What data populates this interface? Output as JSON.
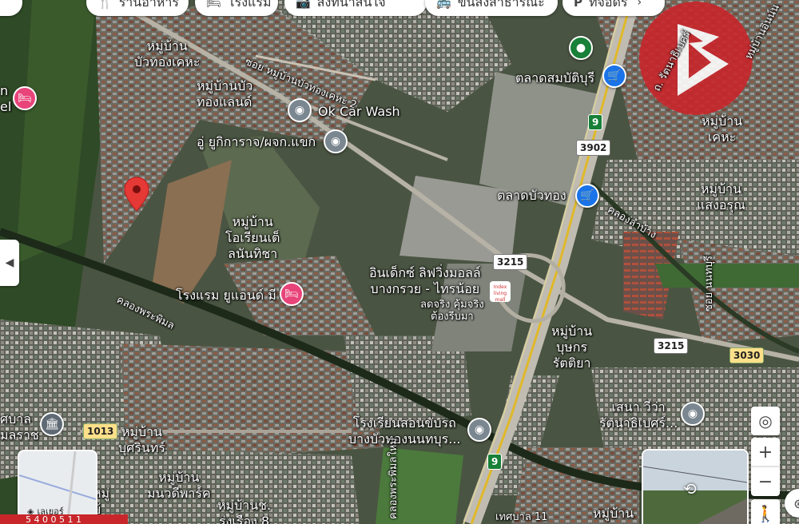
{
  "top_chips": [
    {
      "icon": "fork-knife-icon",
      "glyph": "🍴",
      "label": "ร้านอาหาร"
    },
    {
      "icon": "bed-icon",
      "glyph": "🛏",
      "label": "โรงแรม"
    },
    {
      "icon": "camera-icon",
      "glyph": "📷",
      "label": "สิ่งที่น่าสนใจ"
    },
    {
      "icon": "bus-icon",
      "glyph": "🚌",
      "label": "ขนส่งสาธารณะ"
    },
    {
      "icon": "parking-icon",
      "glyph": "P",
      "label": "ที่จอดร"
    }
  ],
  "places": {
    "moo_buathong_kheha": "หมู่บ้าน\nบัวทองเคหะ",
    "soi_buathong_kheha2": "ซอย หมู่บ้านบัวทองเคหะ 2",
    "moo_buathong_land": "หมู่บ้านบัว\nทองแลนด์",
    "ok_car_wash": "Ok Car Wash",
    "auto_garage": "อู่ ยูกิการาจ/ผจก.แขก",
    "talat_sombat": "ตลาดสมบัติบุรี",
    "moo_kheha_right": "หมู่บ้าน\nเคหะ",
    "talat_buathong": "ตลาดบัวทอง",
    "moo_saengarun": "หมู่บ้าน\nแสงอรุณ",
    "moo_orient": "หมู่บ้าน\nโอเรียนเต็\nลนันทิชา",
    "index_mall": "อินเด็กซ์ ลิฟวิ่งมอลล์\nบางกรวย - ไทรน้อย",
    "index_sub": "ลดจริง คุ้มจริง\nต้องรีบมา",
    "hotel_u_and_me": "โรงแรม ยูแอนด์ มี",
    "moo_buttakorn": "หมู่บ้าน\nบุษกร\nรัตติยา",
    "sena_viva": "เสนา วีว่า\nรัตนาธิเบศร์...",
    "driving_school": "โรงเรียนสอนขับรถ\nบางบัวทองนนทบุร...",
    "moo_boririn": "หมู่บ้าน\nบุศรินทร์",
    "moo_manot": "หมู่บ้าน\nมนวดีพาร์ค",
    "moo_rungrueang": "หมู่บ้านช.\nรุ่งเรือง 8",
    "moo_bottom_right": "หมู่บ้าน",
    "thetsaban": "ศบาล\nมลราช",
    "left_edge_n": "n",
    "left_edge_el": "el",
    "khlong_phra_phimon": "คลองพระพิมล",
    "khlong_lamwang": "คลองลำบ้าง",
    "soi_nonthaburi": "ซอย นนทบุรี",
    "khlong_bottom": "คลองพระพิมลใหม่",
    "road_bottom": "เทศบาล 11",
    "right_vertical": "ถ. รัตนาธิเบศร์",
    "right_top": "หมู่บ้านอินน์น"
  },
  "shields": {
    "r9_top": "9",
    "r3902": "3902",
    "r3215_mid": "3215",
    "r3215_right": "3215",
    "r3030": "3030",
    "r1013": "1013",
    "r9_bottom": "9"
  },
  "index_badge": "Index\nliving mall",
  "thumbnail": {
    "label": "เลเยอร์"
  },
  "bottom_partial": "5 4 0 0 5 1 1",
  "colors": {
    "pin": "#e53935",
    "hotel": "#e8447a",
    "shop": "#1a73e8",
    "generic": "#5f6a74",
    "green": "#188038",
    "brand": "#c8262b"
  }
}
